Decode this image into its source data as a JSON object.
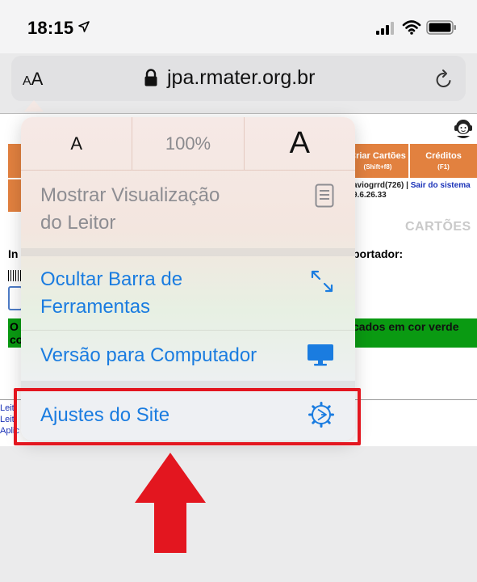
{
  "status_bar": {
    "time": "18:15",
    "icons": [
      "location-arrow-icon",
      "cellular-signal-icon",
      "wifi-icon",
      "battery-icon"
    ]
  },
  "address_bar": {
    "text_size_button": "AA",
    "url": "jpa.rmater.org.br",
    "icons": [
      "lock-icon",
      "reload-icon"
    ]
  },
  "background_page": {
    "buttons": [
      {
        "label": "Criar Cartões",
        "shortcut": "(Shift+f8)"
      },
      {
        "label": "Créditos",
        "shortcut": "(F1)"
      }
    ],
    "user": "aviogrrd(726)",
    "separator": "|",
    "logout_link": "Sair do sistema",
    "version": "9.6.26.33",
    "section_title": "CARTÕES",
    "label_left": "In",
    "label_portador": "portador:",
    "green_notice": "cados em cor verde",
    "green_notice_left": "O",
    "green_notice_left2": "co",
    "left_links": [
      "Leit",
      "Leit",
      "Aplic"
    ]
  },
  "popover": {
    "font_smaller": "A",
    "zoom_level": "100%",
    "font_larger": "A",
    "items": [
      {
        "label": "Mostrar Visualização do Leitor",
        "line1": "Mostrar Visualização",
        "line2": "do Leitor",
        "icon": "reader-icon",
        "enabled": false
      },
      {
        "label": "Ocultar Barra de Ferramentas",
        "line1": "Ocultar Barra de",
        "line2": "Ferramentas",
        "icon": "expand-arrows-icon",
        "enabled": true
      },
      {
        "label": "Versão para Computador",
        "icon": "desktop-icon",
        "enabled": true
      },
      {
        "label": "Ajustes do Site",
        "icon": "gear-icon",
        "enabled": true
      }
    ]
  },
  "annotation": {
    "highlight_color": "#e3161f",
    "target": "Ajustes do Site"
  },
  "colors": {
    "link_blue": "#1a7ce0",
    "orange": "#e2813f",
    "green": "#0a9a12"
  }
}
